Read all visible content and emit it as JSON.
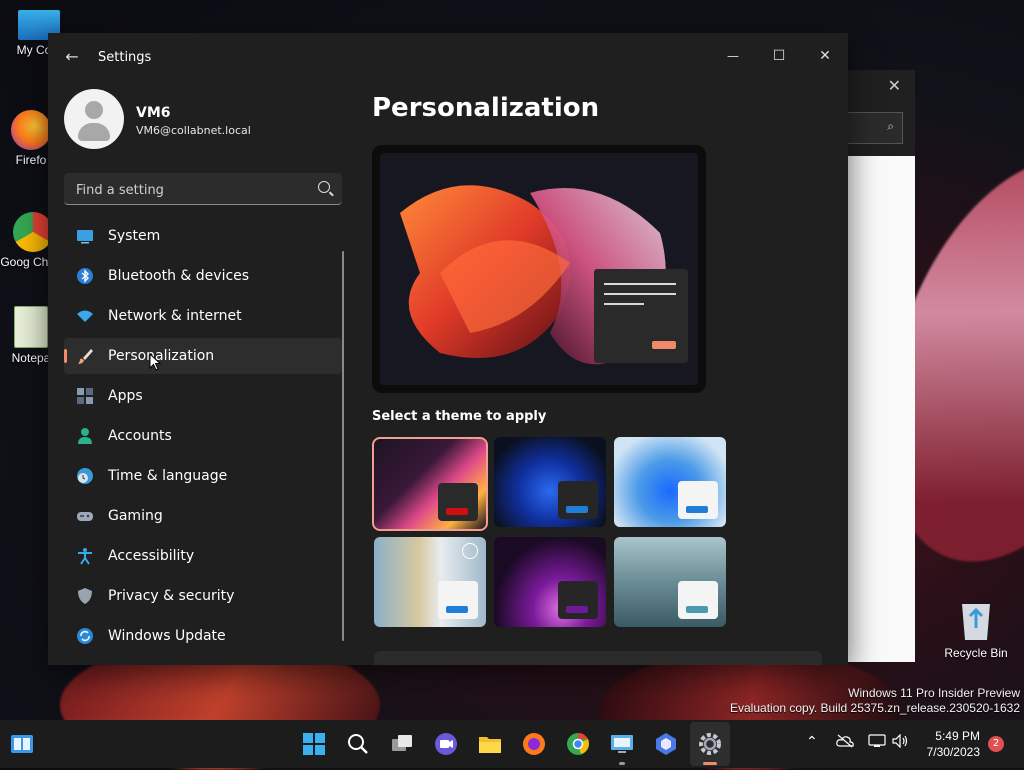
{
  "desktop": {
    "icons": [
      {
        "label": "My Com"
      },
      {
        "label": "Firefo"
      },
      {
        "label": "Goog Chron"
      },
      {
        "label": "Notepa"
      }
    ],
    "recycle_bin": "Recycle Bin",
    "watermark": {
      "line1": "Windows 11 Pro Insider Preview",
      "line2": "Evaluation copy. Build 25375.zn_release.230520-1632"
    }
  },
  "window": {
    "title": "Settings",
    "controls": {
      "minimize": "—",
      "maximize": "☐",
      "close": "✕"
    }
  },
  "profile": {
    "name": "VM6",
    "email": "VM6@collabnet.local"
  },
  "search": {
    "placeholder": "Find a setting"
  },
  "nav": {
    "items": [
      {
        "label": "System",
        "icon": "system-icon"
      },
      {
        "label": "Bluetooth & devices",
        "icon": "bluetooth-icon"
      },
      {
        "label": "Network & internet",
        "icon": "wifi-icon"
      },
      {
        "label": "Personalization",
        "icon": "brush-icon",
        "active": true
      },
      {
        "label": "Apps",
        "icon": "apps-icon"
      },
      {
        "label": "Accounts",
        "icon": "account-icon"
      },
      {
        "label": "Time & language",
        "icon": "clock-globe-icon"
      },
      {
        "label": "Gaming",
        "icon": "gamepad-icon"
      },
      {
        "label": "Accessibility",
        "icon": "accessibility-icon"
      },
      {
        "label": "Privacy & security",
        "icon": "shield-icon"
      },
      {
        "label": "Windows Update",
        "icon": "update-icon"
      }
    ]
  },
  "main": {
    "title": "Personalization",
    "theme_section_label": "Select a theme to apply",
    "themes": [
      {
        "name": "theme-glow",
        "accent": "#d01010",
        "selected": true
      },
      {
        "name": "theme-dark-bloom",
        "accent": "#1f7fd8"
      },
      {
        "name": "theme-light-bloom",
        "accent": "#1f7fd8"
      },
      {
        "name": "theme-spotlight",
        "accent": "#1f7fd8"
      },
      {
        "name": "theme-captured-motion",
        "accent": "#6a1a9a"
      },
      {
        "name": "theme-flow",
        "accent": "#4a9ab0"
      }
    ]
  },
  "taskbar": {
    "clock_time": "5:49 PM",
    "clock_date": "7/30/2023",
    "notification_count": "2"
  },
  "colors": {
    "accent": "#f08a6a",
    "window_bg": "#1f1f1f"
  }
}
